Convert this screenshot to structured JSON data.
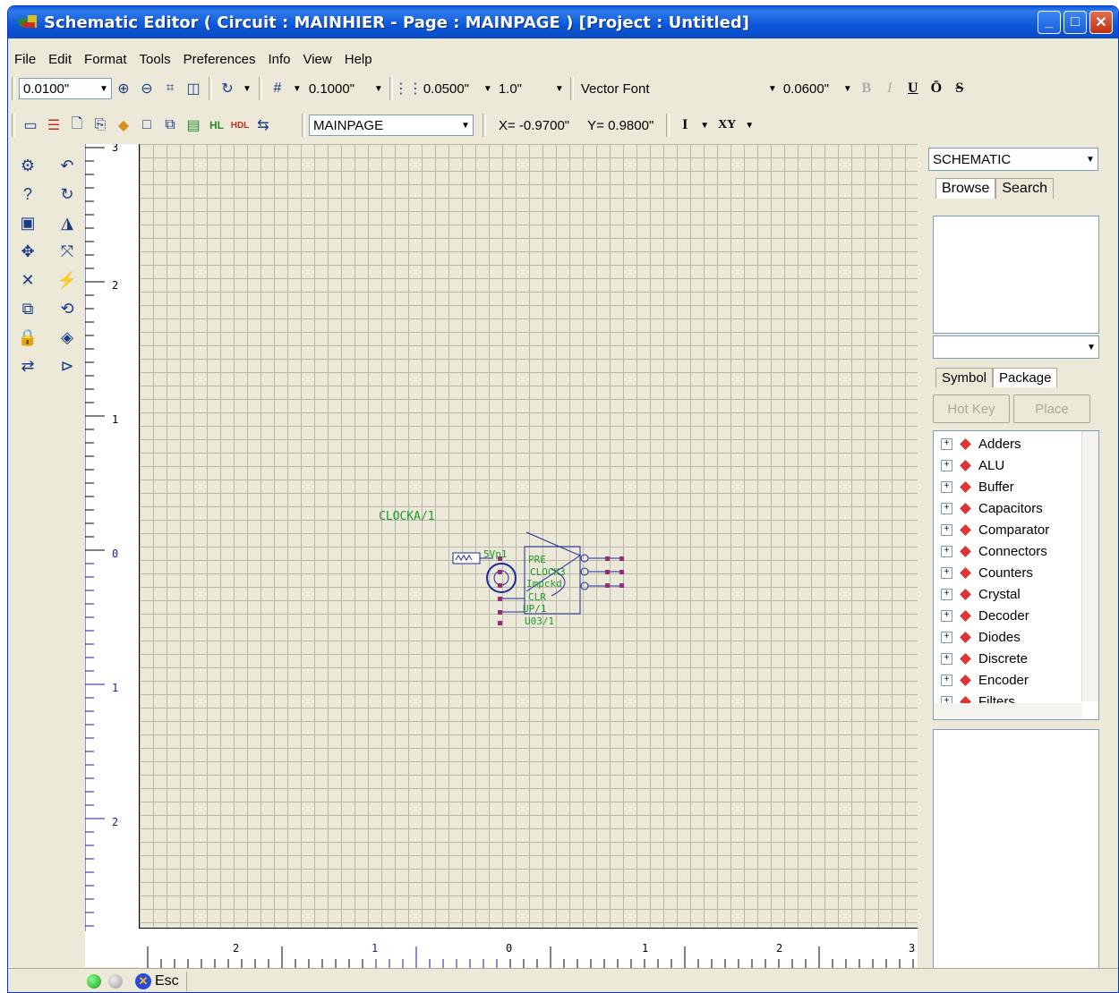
{
  "window": {
    "title": "Schematic Editor ( Circuit : MAINHIER - Page : MAINPAGE ) [Project : Untitled]"
  },
  "menu": [
    "File",
    "Edit",
    "Format",
    "Tools",
    "Preferences",
    "Info",
    "View",
    "Help"
  ],
  "toolbar1": {
    "snap": "0.0100\"",
    "grid": "0.1000\"",
    "spacing": "0.0500\"",
    "line_width": "1.0\"",
    "font": "Vector Font",
    "font_size": "0.0600\"",
    "format_buttons": [
      "B",
      "I",
      "U",
      "Ō",
      "S"
    ]
  },
  "toolbar2": {
    "page": "MAINPAGE",
    "x": "X= -0.9700\"",
    "y": "Y= 0.9800\"",
    "i_button": "I",
    "xy_button": "XY"
  },
  "canvas": {
    "label": "CLOCKA/1",
    "vruler_labels": [
      "3",
      "2",
      "1",
      "0",
      "1",
      "2"
    ],
    "hruler_labels": [
      "2",
      "1",
      "0",
      "1",
      "2",
      "3"
    ],
    "component_texts": [
      "5Vp1",
      "PRE",
      "CLOCK3",
      "Impckd",
      "CLR",
      "UP/1",
      "U03/1"
    ]
  },
  "right_panel": {
    "library": "SCHEMATIC",
    "tabs": [
      "Browse",
      "Search"
    ],
    "tabs2": [
      "Symbol",
      "Package"
    ],
    "hotkey_button": "Hot Key",
    "place_button": "Place",
    "tree": [
      "Adders",
      "ALU",
      "Buffer",
      "Capacitors",
      "Comparator",
      "Connectors",
      "Counters",
      "Crystal",
      "Decoder",
      "Diodes",
      "Discrete",
      "Encoder",
      "Filters"
    ]
  },
  "status": {
    "esc": "Esc"
  },
  "colors": {
    "title_blue": "#0a5bdc",
    "canvas_bg": "#ece9d8",
    "label_green": "#1a9a2a",
    "schematic_blue": "#1a2a9a",
    "pin_purple": "#9a2a7a"
  }
}
